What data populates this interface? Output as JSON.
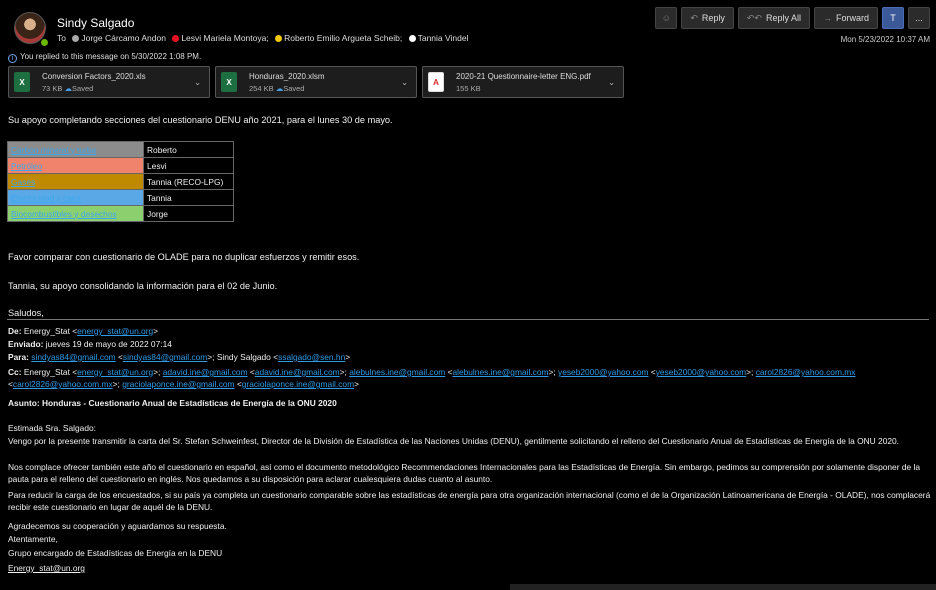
{
  "header": {
    "sender": "Sindy Salgado",
    "to_label": "To",
    "recipients": [
      {
        "name": "Jorge Cárcamo Andon",
        "color": "#a9a9a9"
      },
      {
        "name": "Lesvi Mariela Montoya;",
        "color": "#e81123"
      },
      {
        "name": "Roberto Emilio Argueta Scheib;",
        "color": "#f2c80f"
      },
      {
        "name": "Tannia Vindel",
        "color": "#ffffff"
      }
    ],
    "replied_notice": "You replied to this message on 5/30/2022 1:08 PM.",
    "date": "Mon 5/23/2022 10:37 AM"
  },
  "toolbar": {
    "emoji": "☺",
    "reply": "Reply",
    "reply_all": "Reply All",
    "forward": "Forward",
    "teams": "T",
    "more": "..."
  },
  "attachments": [
    {
      "name": "Conversion Factors_2020.xls",
      "size": "73 KB",
      "status": "Saved",
      "type": "xl"
    },
    {
      "name": "Honduras_2020.xlsm",
      "size": "254 KB",
      "status": "Saved",
      "type": "xl"
    },
    {
      "name": "2020-21 Questionnaire-letter ENG.pdf",
      "size": "155 KB",
      "status": "",
      "type": "pdf"
    }
  ],
  "body": {
    "line1": "Su apoyo completando secciones del cuestionario DENU año 2021, para el lunes 30 de mayo.",
    "table": [
      {
        "category": "Carbon mineral y turba",
        "name": "Roberto",
        "bg": "#8c8c8c"
      },
      {
        "category": "Petróleo",
        "name": "Lesvi",
        "bg": "#f0836b"
      },
      {
        "category": "Gases",
        "name": "Tannia (RECO-LPG)",
        "bg": "#c08a00"
      },
      {
        "category": "Electricidad y calor",
        "name": "Tannia",
        "bg": "#5aa9e6"
      },
      {
        "category": "Biocombustibles y desechos",
        "name": "Jorge",
        "bg": "#8ccf6e"
      }
    ],
    "line2": "Favor comparar con cuestionario de OLADE para no duplicar esfuerzos y remitir esos.",
    "line3": "Tannia, su apoyo consolidando la información para el 02 de Junio.",
    "line4": "Saludos,"
  },
  "forwarded": {
    "de_label": "De:",
    "de_name": "Energy_Stat <",
    "de_email": "energy_stat@un.org",
    "de_end": ">",
    "enviado_label": "Enviado:",
    "enviado": "jueves 19 de mayo de 2022 07:14",
    "para_label": "Para:",
    "para_email1": "sindyas84@gmail.com",
    "para_email2": "sindyas84@gmail.com",
    "para_name": "Sindy Salgado <",
    "para_email3": "ssalgado@sen.hn",
    "cc_label": "Cc:",
    "cc_name": "Energy_Stat <",
    "cc_l1": "energy_stat@un.org",
    "cc_l2": "adavid.ine@gmail.com",
    "cc_l3": "adavid.ine@gmail.com",
    "cc_l4": "alebulnes.ine@gmail.com",
    "cc_l5": "alebulnes.ine@gmail.com",
    "cc_l6": "yeseb2000@yahoo.com",
    "cc_l7": "yeseb2000@yahoo.com",
    "cc_l8": "carol2826@yahoo.com.mx",
    "cc_l9": "carol2826@yahoo.com.mx",
    "cc_l10": "graciolaponce.ine@gmail.com",
    "cc_l11": "graciolaponce.ine@gmail.com",
    "asunto_label": "Asunto:",
    "asunto": "Honduras - Cuestionario Anual de Estadísticas de Energía de la ONU 2020",
    "greeting": "Estimada Sra. Salgado:",
    "p1": "Vengo por la presente transmitir la carta del Sr. Stefan Schweinfest, Director de la División de Estadística de las Naciones Unidas (DENU), gentilmente solicitando el relleno del Cuestionario Anual de Estadísticas de Energía de la ONU 2020.",
    "p2": "Nos complace ofrecer también este año el cuestionario en español, así como el documento metodológico Recommendaciones Internacionales para las Estadísticas de Energía. Sin embargo, pedimos su comprensión por solamente disponer de la pauta para el relleno del cuestionario en inglés. Nos quedamos a su disposición para aclarar cualesquiera dudas cuanto al asunto.",
    "p3": "Para reducir la carga de los encuestados, si su país ya completa un cuestionario comparable sobre las estadísticas de energía para otra organización internacional (como el de la Organización Latinoamericana de Energía - OLADE), nos complacerá recibir este cuestionario en lugar de aquél de la DENU.",
    "p4": "Agradecemos su cooperación y aguardamos su respuesta.",
    "p5": "Atentamente,",
    "p6": "Grupo encargado de Estadísticas de Energía en la DENU",
    "sig_email": "Energy_stat@un.org"
  }
}
